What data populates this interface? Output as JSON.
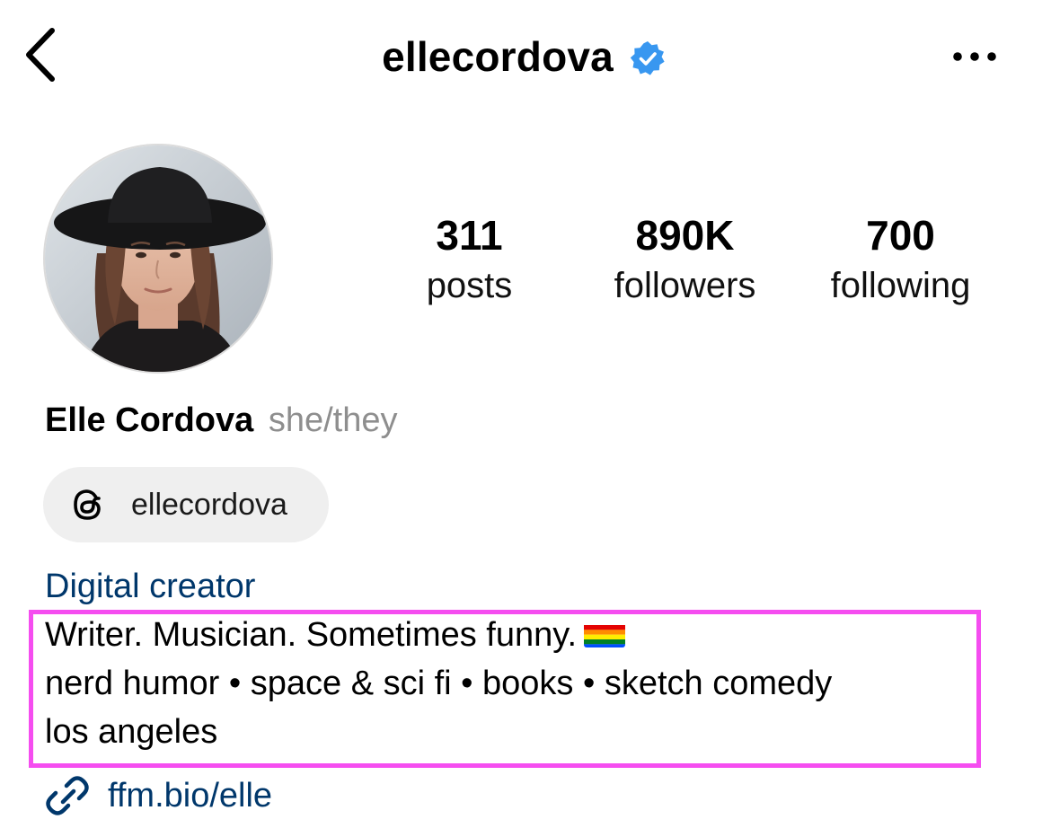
{
  "header": {
    "username": "ellecordova",
    "verified": true,
    "back_icon": "chevron-left-icon",
    "more_icon": "more-horizontal-icon"
  },
  "stats": {
    "posts": {
      "value": "311",
      "label": "posts"
    },
    "followers": {
      "value": "890K",
      "label": "followers"
    },
    "following": {
      "value": "700",
      "label": "following"
    }
  },
  "profile": {
    "full_name": "Elle Cordova",
    "pronouns": "she/they",
    "threads_handle": "ellecordova",
    "category": "Digital creator",
    "bio_lines": [
      "Writer. Musician. Sometimes funny.",
      "nerd humor • space & sci fi • books • sketch comedy",
      "los angeles"
    ],
    "bio_emoji": "rainbow-flag",
    "link": "ffm.bio/elle"
  },
  "colors": {
    "verified_blue": "#3897f0",
    "link_blue": "#00376b",
    "highlight_magenta": "#f54df0",
    "pill_bg": "#efefef",
    "pronoun_gray": "#8e8e8e"
  }
}
